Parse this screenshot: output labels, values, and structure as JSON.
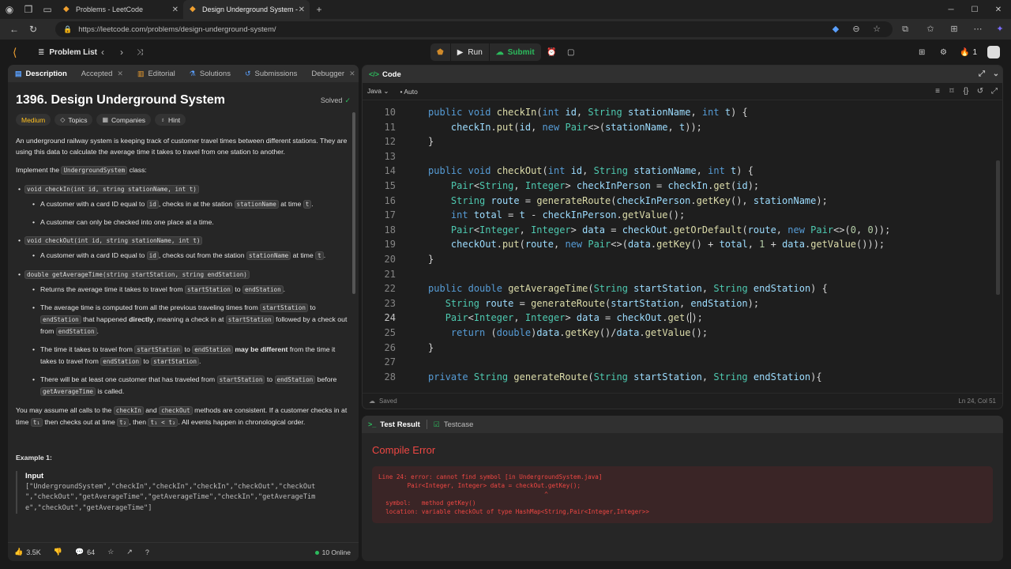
{
  "browser": {
    "tabs": [
      {
        "title": "Problems - LeetCode"
      },
      {
        "title": "Design Underground System - Le"
      }
    ],
    "url": "https://leetcode.com/problems/design-underground-system/"
  },
  "header": {
    "problem_list": "Problem List",
    "run": "Run",
    "submit": "Submit",
    "streak": "1"
  },
  "left_tabs": [
    {
      "label": "Description"
    },
    {
      "label": "Accepted"
    },
    {
      "label": "Editorial"
    },
    {
      "label": "Solutions"
    },
    {
      "label": "Submissions"
    },
    {
      "label": "Debugger"
    }
  ],
  "problem": {
    "title": "1396. Design Underground System",
    "solved": "Solved",
    "tags": {
      "difficulty": "Medium",
      "topics": "Topics",
      "companies": "Companies",
      "hint": "Hint"
    },
    "intro": "An underground railway system is keeping track of customer travel times between different stations. They are using this data to calculate the average time it takes to travel from one station to another.",
    "implement_pre": "Implement the ",
    "implement_code": "UndergroundSystem",
    "implement_post": " class:",
    "m1_sig": "void checkIn(int id, string stationName, int t)",
    "m1_b1_a": "A customer with a card ID equal to ",
    "m1_b1_c1": "id",
    "m1_b1_b": ", checks in at the station ",
    "m1_b1_c2": "stationName",
    "m1_b1_c": " at time ",
    "m1_b1_c3": "t",
    "m1_b1_d": ".",
    "m1_b2": "A customer can only be checked into one place at a time.",
    "m2_sig": "void checkOut(int id, string stationName, int t)",
    "m2_b1_a": "A customer with a card ID equal to ",
    "m2_b1_c1": "id",
    "m2_b1_b": ", checks out from the station ",
    "m2_b1_c2": "stationName",
    "m2_b1_c": " at time ",
    "m2_b1_c3": "t",
    "m2_b1_d": ".",
    "m3_sig": "double getAverageTime(string startStation, string endStation)",
    "m3_b1_a": "Returns the average time it takes to travel from ",
    "m3_b1_c1": "startStation",
    "m3_b1_b": " to ",
    "m3_b1_c2": "endStation",
    "m3_b1_c": ".",
    "m3_b2_a": "The average time is computed from all the previous traveling times from ",
    "m3_b2_c1": "startStation",
    "m3_b2_b": " to ",
    "m3_b2_c2": "endStation",
    "m3_b2_c": " that happened ",
    "m3_b2_bold": "directly",
    "m3_b2_d": ", meaning a check in at ",
    "m3_b2_c3": "startStation",
    "m3_b2_e": " followed by a check out from ",
    "m3_b2_c4": "endStation",
    "m3_b2_f": ".",
    "m3_b3_a": "The time it takes to travel from ",
    "m3_b3_c1": "startStation",
    "m3_b3_b": " to ",
    "m3_b3_c2": "endStation",
    "m3_b3_bold": " may be different",
    "m3_b3_c": " from the time it takes to travel from ",
    "m3_b3_c3": "endStation",
    "m3_b3_d": " to ",
    "m3_b3_c4": "startStation",
    "m3_b3_e": ".",
    "m3_b4_a": "There will be at least one customer that has traveled from ",
    "m3_b4_c1": "startStation",
    "m3_b4_b": " to ",
    "m3_b4_c2": "endStation",
    "m3_b4_c": " before ",
    "m3_b4_c3": "getAverageTime",
    "m3_b4_d": " is called.",
    "assume_a": "You may assume all calls to the ",
    "assume_c1": "checkIn",
    "assume_b": " and ",
    "assume_c2": "checkOut",
    "assume_c": " methods are consistent. If a customer checks in at time ",
    "assume_c3": "t₁",
    "assume_d": " then checks out at time ",
    "assume_c4": "t₂",
    "assume_e": ", then ",
    "assume_c5": "t₁ < t₂",
    "assume_f": ". All events happen in chronological order.",
    "example_title": "Example 1:",
    "example_input_label": "Input",
    "example_input_l1": "[\"UndergroundSystem\",\"checkIn\",\"checkIn\",\"checkIn\",\"checkOut\",\"checkOut",
    "example_input_l2": "\",\"checkOut\",\"getAverageTime\",\"getAverageTime\",\"checkIn\",\"getAverageTim",
    "example_input_l3": "e\",\"checkOut\",\"getAverageTime\"]"
  },
  "left_footer": {
    "likes": "3.5K",
    "comments": "64",
    "online": "10 Online"
  },
  "code": {
    "title": "Code",
    "language": "Java",
    "mode": "Auto",
    "saved": "Saved",
    "cursor": "Ln 24, Col 51"
  },
  "result": {
    "tab_result": "Test Result",
    "tab_testcase": "Testcase",
    "title": "Compile Error",
    "message": "Line 24: error: cannot find symbol [in UndergroundSystem.java]\n        Pair<Integer, Integer> data = checkOut.getKey();\n                                              ^\n  symbol:   method getKey()\n  location: variable checkOut of type HashMap<String,Pair<Integer,Integer>>"
  }
}
